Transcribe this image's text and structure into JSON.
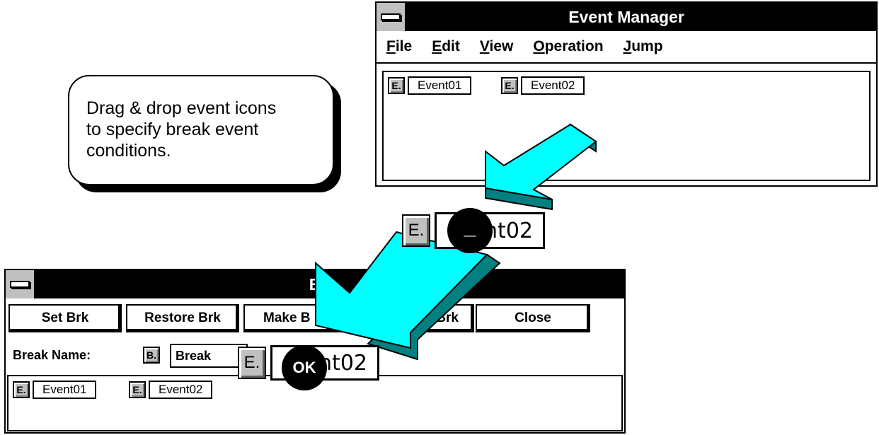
{
  "callout": {
    "line1": "Drag & drop event icons",
    "line2": "to specify break event",
    "line3": "conditions."
  },
  "event_manager": {
    "title": "Event Manager",
    "menu": [
      {
        "label": "File",
        "accel": "F",
        "rest": "ile"
      },
      {
        "label": "Edit",
        "accel": "E",
        "rest": "dit"
      },
      {
        "label": "View",
        "accel": "V",
        "rest": "iew"
      },
      {
        "label": "Operation",
        "accel": "O",
        "rest": "peration"
      },
      {
        "label": "Jump",
        "accel": "J",
        "rest": "ump"
      }
    ],
    "events": [
      {
        "icon": "E.",
        "label": "Event01"
      },
      {
        "icon": "E.",
        "label": "Event02"
      }
    ]
  },
  "drag_ghost_1": {
    "icon": "E.",
    "label_visible": "nt02",
    "cursor": "_"
  },
  "drag_ghost_2": {
    "icon": "E.",
    "label_visible": "nt02",
    "cursor": "OK"
  },
  "break_window": {
    "title_visible": "B",
    "buttons": [
      "Set Brk",
      "Restore Brk",
      "Make B",
      "cel Brk",
      "Close"
    ],
    "break_name_label": "Break Name:",
    "break_icon": "B.",
    "break_name_value": "Break",
    "events": [
      {
        "icon": "E.",
        "label": "Event01"
      },
      {
        "icon": "E.",
        "label": "Event02"
      }
    ]
  },
  "colors": {
    "arrow_face": "#00ffff",
    "arrow_side": "#008080",
    "title_bg": "#000000",
    "button_face": "#c0c0c0"
  }
}
